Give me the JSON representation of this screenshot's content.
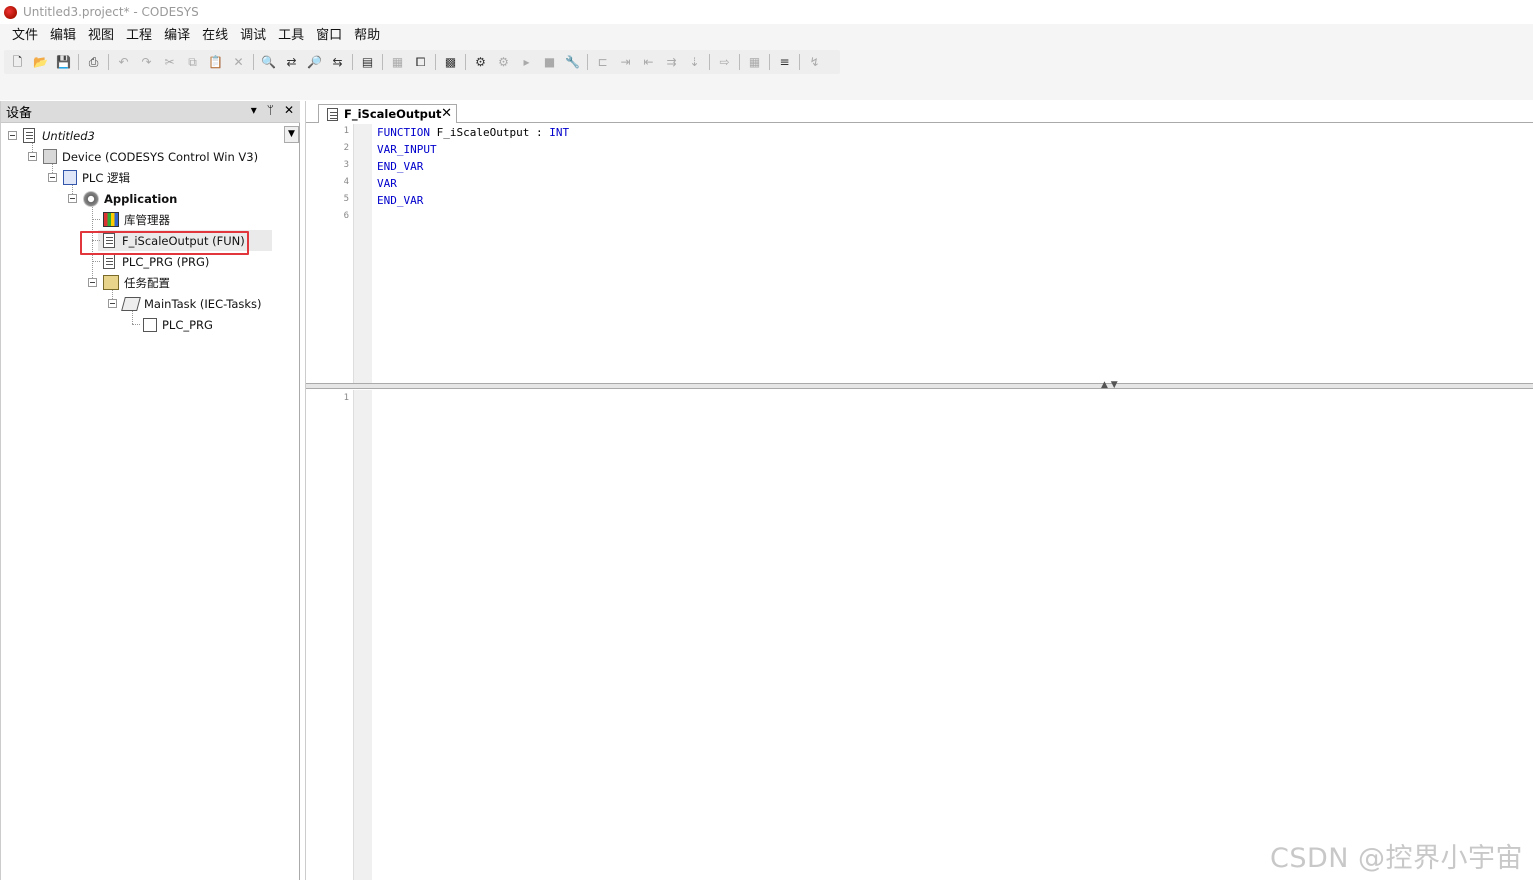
{
  "window": {
    "title": "Untitled3.project* - CODESYS"
  },
  "menu": [
    "文件",
    "编辑",
    "视图",
    "工程",
    "编译",
    "在线",
    "调试",
    "工具",
    "窗口",
    "帮助"
  ],
  "toolbar": {
    "buttons": [
      {
        "name": "new-icon",
        "glyph": "🗋"
      },
      {
        "name": "open-icon",
        "glyph": "📂"
      },
      {
        "name": "save-icon",
        "glyph": "💾"
      },
      {
        "sep": true
      },
      {
        "name": "print-icon",
        "glyph": "⎙"
      },
      {
        "sep": true
      },
      {
        "name": "undo-icon",
        "glyph": "↶",
        "dim": true
      },
      {
        "name": "redo-icon",
        "glyph": "↷",
        "dim": true
      },
      {
        "name": "cut-icon",
        "glyph": "✂",
        "dim": true
      },
      {
        "name": "copy-icon",
        "glyph": "⧉",
        "dim": true
      },
      {
        "name": "paste-icon",
        "glyph": "📋",
        "dim": true
      },
      {
        "name": "delete-icon",
        "glyph": "✕",
        "dim": true
      },
      {
        "sep": true
      },
      {
        "name": "find-icon",
        "glyph": "🔍"
      },
      {
        "name": "replace-icon",
        "glyph": "⇄"
      },
      {
        "name": "find-in-project-icon",
        "glyph": "🔎"
      },
      {
        "name": "replace-in-project-icon",
        "glyph": "⇆"
      },
      {
        "sep": true
      },
      {
        "name": "window-list-icon",
        "glyph": "▤"
      },
      {
        "sep": true
      },
      {
        "name": "grid-dropdown-icon",
        "glyph": "▦",
        "dim": true
      },
      {
        "name": "new-window-icon",
        "glyph": "⧠"
      },
      {
        "sep": true
      },
      {
        "name": "build-icon",
        "glyph": "▩"
      },
      {
        "sep": true
      },
      {
        "name": "login-icon",
        "glyph": "⚙"
      },
      {
        "name": "logout-icon",
        "glyph": "⚙",
        "dim": true
      },
      {
        "name": "start-icon",
        "glyph": "▸",
        "dim": true
      },
      {
        "name": "stop-icon",
        "glyph": "■",
        "dim": true
      },
      {
        "name": "reset-icon",
        "glyph": "🔧"
      },
      {
        "sep": true
      },
      {
        "name": "breakpoint-icon",
        "glyph": "⊏",
        "dim": true
      },
      {
        "name": "step-over-icon",
        "glyph": "⇥",
        "dim": true
      },
      {
        "name": "step-into-icon",
        "glyph": "⇤",
        "dim": true
      },
      {
        "name": "step-out-icon",
        "glyph": "⇉",
        "dim": true
      },
      {
        "name": "run-to-cursor-icon",
        "glyph": "⇣",
        "dim": true
      },
      {
        "sep": true
      },
      {
        "name": "set-next-statement-icon",
        "glyph": "⇨",
        "dim": true
      },
      {
        "sep": true
      },
      {
        "name": "write-values-icon",
        "glyph": "▦",
        "dim": true
      },
      {
        "sep": true
      },
      {
        "name": "force-values-icon",
        "glyph": "≡"
      },
      {
        "sep": true
      },
      {
        "name": "unforce-icon",
        "glyph": "↯",
        "dim": true
      }
    ]
  },
  "devices_panel": {
    "title": "设备",
    "pin_glyph": "▾",
    "autohide_glyph": "ᛘ",
    "close_glyph": "✕",
    "tree": [
      {
        "label": "Untitled3",
        "italic": true
      },
      {
        "label": "Device (CODESYS Control Win V3)"
      },
      {
        "label": "PLC 逻辑"
      },
      {
        "label": "Application",
        "bold": true
      },
      {
        "label": "库管理器"
      },
      {
        "label": "F_iScaleOutput (FUN)"
      },
      {
        "label": "PLC_PRG (PRG)"
      },
      {
        "label": "任务配置"
      },
      {
        "label": "MainTask (IEC-Tasks)"
      },
      {
        "label": "PLC_PRG"
      }
    ]
  },
  "editor": {
    "tab_label": "F_iScaleOutput",
    "declaration_lines": [
      {
        "no": "1",
        "tokens": [
          {
            "t": "FUNCTION",
            "kw": true
          },
          {
            "t": " F_iScaleOutput : ",
            "kw": false
          },
          {
            "t": "INT",
            "kw": true
          }
        ]
      },
      {
        "no": "2",
        "tokens": [
          {
            "t": "VAR_INPUT",
            "kw": true
          }
        ]
      },
      {
        "no": "3",
        "tokens": [
          {
            "t": "END_VAR",
            "kw": true
          }
        ]
      },
      {
        "no": "4",
        "tokens": [
          {
            "t": "VAR",
            "kw": true
          }
        ]
      },
      {
        "no": "5",
        "tokens": [
          {
            "t": "END_VAR",
            "kw": true
          }
        ]
      },
      {
        "no": "6",
        "tokens": []
      }
    ],
    "body_lines": [
      {
        "no": "1"
      }
    ],
    "splitter_arrows": "▲ ▼"
  },
  "watermark": "CSDN @控界小宇宙"
}
